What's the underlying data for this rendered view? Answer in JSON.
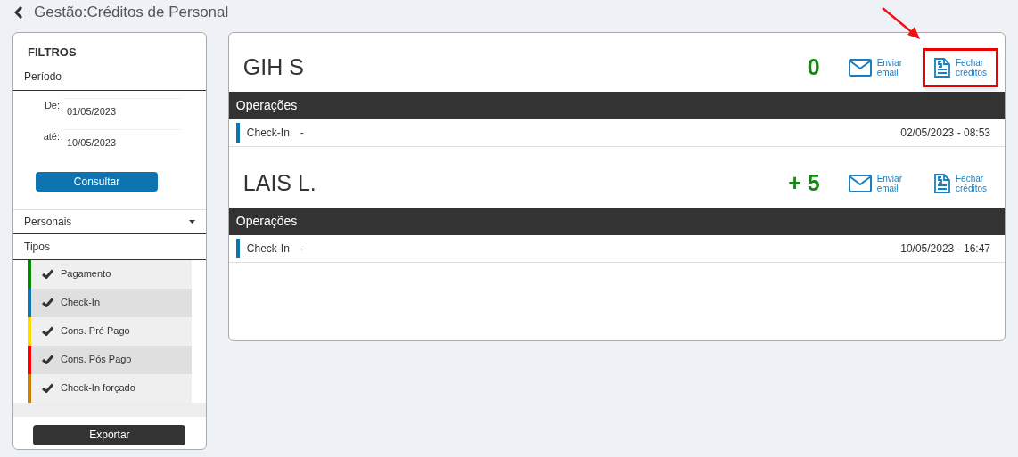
{
  "header": {
    "title": "Gestão:Créditos de Personal"
  },
  "filters": {
    "title": "FILTROS",
    "period_label": "Período",
    "from_label": "De:",
    "from_value": "01/05/2023",
    "to_label": "até:",
    "to_value": "10/05/2023",
    "query_button": "Consultar",
    "personals_label": "Personais",
    "personals_expanded": false,
    "types_label": "Tipos",
    "types": [
      {
        "label": "Pagamento",
        "checked": true,
        "color": "#008a00"
      },
      {
        "label": "Check-In",
        "checked": true,
        "color": "#0d73b1"
      },
      {
        "label": "Cons. Pré Pago",
        "checked": true,
        "color": "#ffd800"
      },
      {
        "label": "Cons. Pós Pago",
        "checked": true,
        "color": "#ff0000"
      },
      {
        "label": "Check-In forçado",
        "checked": true,
        "color": "#c87f0a"
      }
    ],
    "export_button": "Exportar"
  },
  "personals": [
    {
      "name": "GIH S",
      "credits": "0",
      "actions": [
        {
          "kind": "email",
          "label_1": "Enviar",
          "label_2": "email",
          "highlighted": false
        },
        {
          "kind": "close",
          "label_1": "Fechar",
          "label_2": "créditos",
          "highlighted": true
        }
      ],
      "operations_title": "Operações",
      "operations": [
        {
          "type": "Check-In",
          "detail": "-",
          "datetime": "02/05/2023 - 08:53",
          "color": "#0d73b1"
        }
      ]
    },
    {
      "name": "LAIS L.",
      "credits": "+ 5",
      "actions": [
        {
          "kind": "email",
          "label_1": "Enviar",
          "label_2": "email",
          "highlighted": false
        },
        {
          "kind": "close",
          "label_1": "Fechar",
          "label_2": "créditos",
          "highlighted": false
        }
      ],
      "operations_title": "Operações",
      "operations": [
        {
          "type": "Check-In",
          "detail": "-",
          "datetime": "10/05/2023 - 16:47",
          "color": "#0d73b1"
        }
      ]
    }
  ]
}
